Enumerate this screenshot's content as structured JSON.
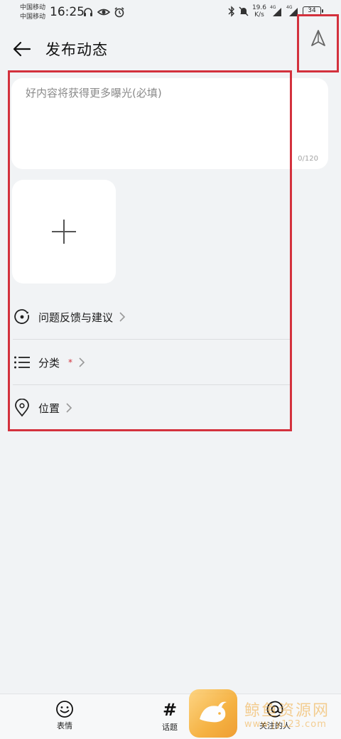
{
  "status_bar": {
    "carrier_1": "中国移动",
    "carrier_2": "中国移动",
    "time": "16:25",
    "net_speed_value": "19.6",
    "net_speed_unit": "K/s",
    "signal_1": "4G",
    "signal_2": "4G",
    "battery": "34"
  },
  "header": {
    "title": "发布动态"
  },
  "compose": {
    "placeholder": "好内容将获得更多曝光(必填)",
    "char_count": "0/120"
  },
  "options": [
    {
      "label": "问题反馈与建议",
      "icon": "feedback-icon"
    },
    {
      "label": "分类",
      "icon": "list-icon",
      "required_mark": "*"
    },
    {
      "label": "位置",
      "icon": "location-pin-icon"
    }
  ],
  "toolbar": {
    "emoji_label": "表情",
    "topic_symbol": "#",
    "topic_label": "话题",
    "mention_label": "关注的人"
  },
  "watermark": {
    "text": "鲸鱼资源网",
    "url": "www.jy123.com"
  },
  "colors": {
    "highlight": "#d3313d",
    "background": "#f1f3f5",
    "card": "#ffffff",
    "required": "#d0303a"
  }
}
